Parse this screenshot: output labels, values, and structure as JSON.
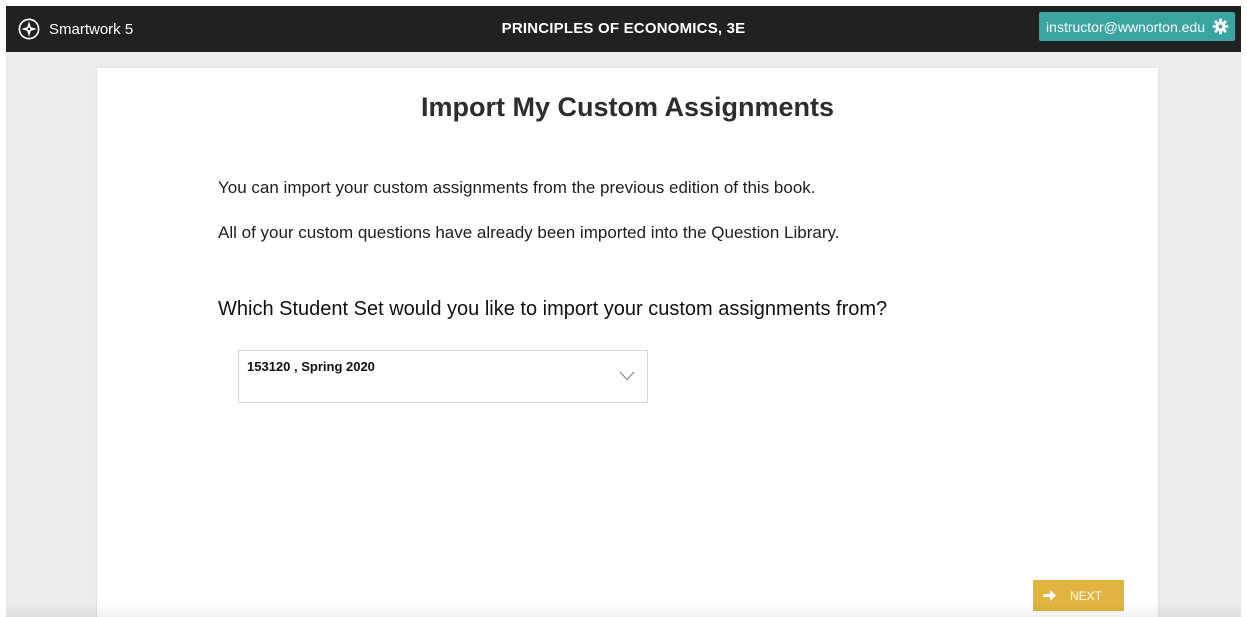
{
  "topbar": {
    "app_name": "Smartwork 5",
    "course_title": "PRINCIPLES OF ECONOMICS, 3E",
    "user_email": "instructor@wwnorton.edu",
    "background_color": "#212121",
    "user_button_color": "#3aa4a0",
    "icons": {
      "logo": "compass-logo-icon",
      "settings": "gear-icon"
    }
  },
  "main": {
    "title": "Import My Custom Assignments",
    "paragraphs": [
      "You can import your custom assignments from the previous edition of this book.",
      "All of your custom questions have already been imported into the Question Library."
    ],
    "question": "Which Student Set would you like to import your custom assignments from?",
    "student_set_select": {
      "selected_value": "153120 , Spring 2020",
      "icon": "chevron-down-icon"
    },
    "next_button": {
      "label": "NEXT",
      "icon": "arrow-right-icon",
      "color": "#e0b43e"
    }
  }
}
